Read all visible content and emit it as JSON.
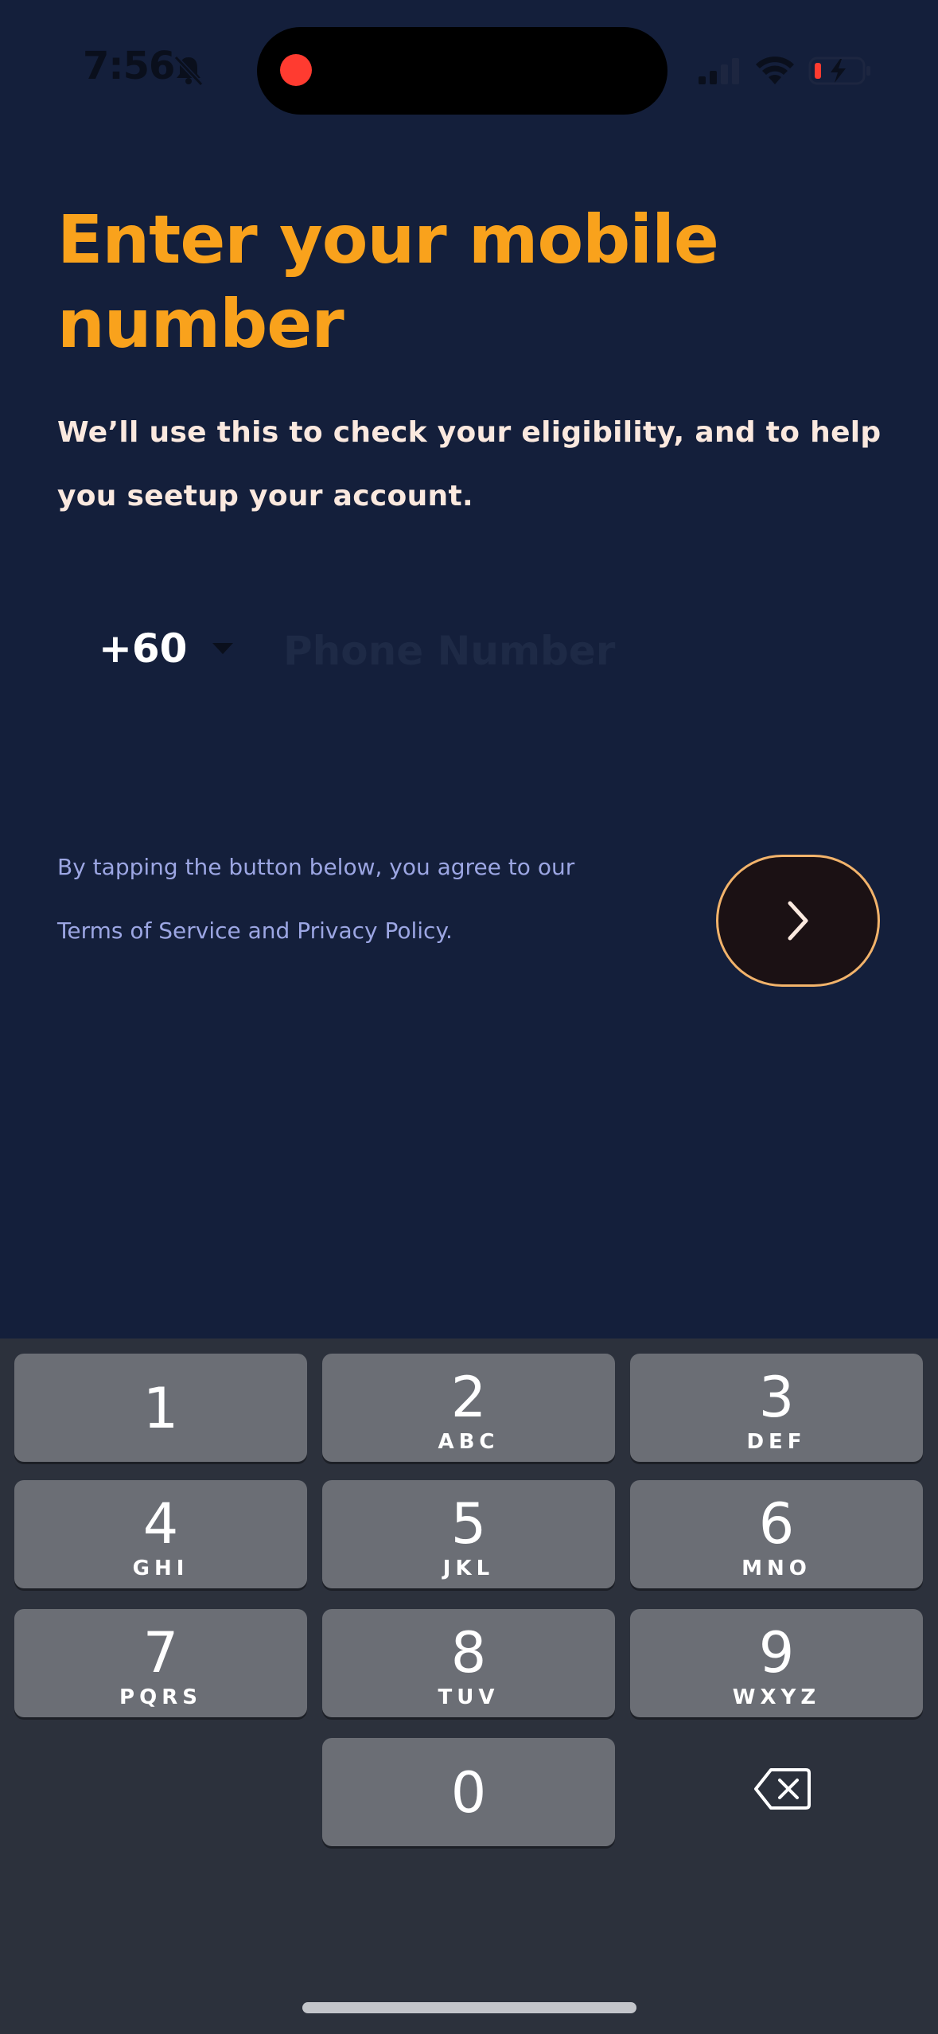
{
  "status_bar": {
    "time": "7:56",
    "icons": [
      "bell-slash-icon",
      "recording-dot",
      "cellular-signal-icon",
      "wifi-icon",
      "battery-charging-icon"
    ]
  },
  "header": {
    "title": "Enter your mobile number",
    "subtitle": "We’ll use this to check your eligibility, and to help you seetup your account."
  },
  "phone": {
    "country_code": "+60",
    "placeholder": "Phone Number",
    "value": ""
  },
  "terms": {
    "text": "By tapping the button below, you agree to our",
    "link_text": "Terms of Service and Privacy Policy."
  },
  "next_button": {
    "icon": "chevron-right-icon"
  },
  "keyboard": {
    "keys": [
      {
        "digit": "1",
        "letters": ""
      },
      {
        "digit": "2",
        "letters": "ABC"
      },
      {
        "digit": "3",
        "letters": "DEF"
      },
      {
        "digit": "4",
        "letters": "GHI"
      },
      {
        "digit": "5",
        "letters": "JKL"
      },
      {
        "digit": "6",
        "letters": "MNO"
      },
      {
        "digit": "7",
        "letters": "PQRS"
      },
      {
        "digit": "8",
        "letters": "TUV"
      },
      {
        "digit": "9",
        "letters": "WXYZ"
      },
      {
        "digit": "0",
        "letters": ""
      }
    ],
    "delete_icon": "delete-backspace-icon"
  },
  "colors": {
    "background": "#141f3b",
    "accent": "#f9a21c",
    "button_border": "#f2b36b",
    "keyboard_bg": "#2c313c",
    "key_bg": "#6b6e75"
  }
}
